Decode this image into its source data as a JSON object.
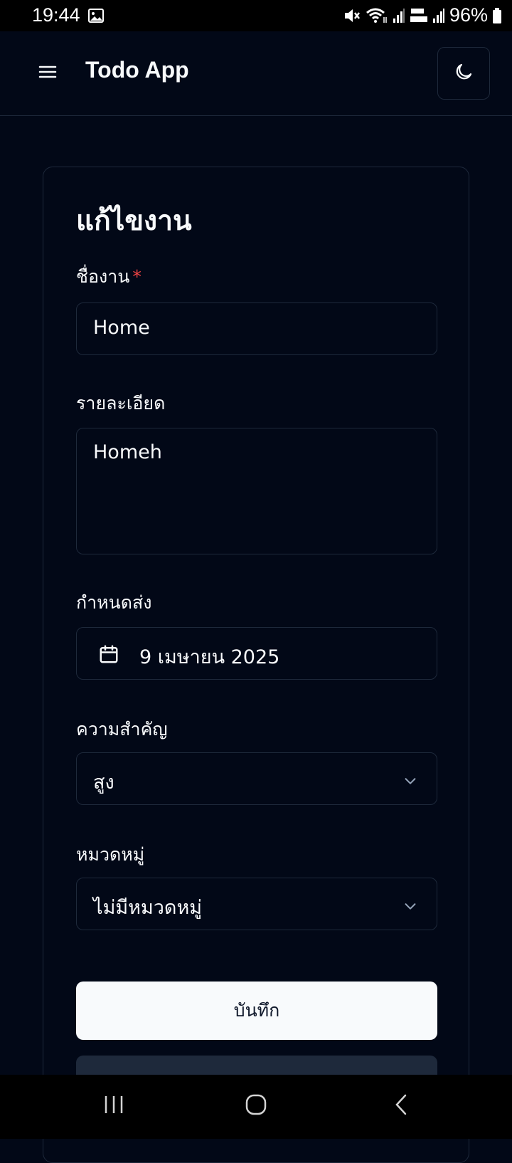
{
  "status_bar": {
    "time": "19:44",
    "battery": "96%"
  },
  "header": {
    "title": "Todo App",
    "menu_icon": "menu-icon",
    "theme_icon": "moon-icon"
  },
  "form": {
    "title": "แก้ไขงาน",
    "name_label": "ชื่องาน",
    "required_mark": "*",
    "name_value": "Home",
    "description_label": "รายละเอียด",
    "description_value": "Homeh",
    "due_label": "กำหนดส่ง",
    "due_value": "9 เมษายน 2025",
    "priority_label": "ความสำคัญ",
    "priority_value": "สูง",
    "category_label": "หมวดหมู่",
    "category_value": "ไม่มีหมวดหมู่",
    "save_label": "บันทึก"
  },
  "colors": {
    "background": "#020817",
    "border": "#1e293b",
    "required": "#ef4444",
    "primary_button": "#f8fafc"
  }
}
